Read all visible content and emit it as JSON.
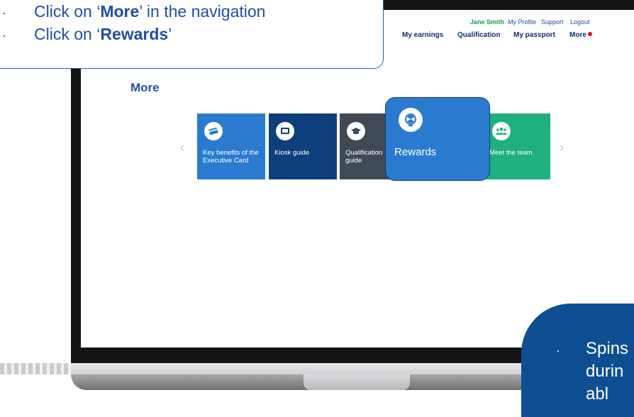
{
  "instructions": {
    "line1_prefix": "Click on ",
    "line1_bold": "More",
    "line1_suffix": " in the navigation",
    "line2_prefix": "Click on ",
    "line2_bold": "Rewards",
    "quote_open": "‘",
    "quote_close": "’",
    "bullet": "·"
  },
  "header": {
    "user_name": "Jane Smith",
    "links": [
      "My Profile",
      "Support",
      "Logout"
    ],
    "nav": [
      "My earnings",
      "Qualification",
      "My passport",
      "More"
    ],
    "notification_color": "#e0102a"
  },
  "page": {
    "title": "More"
  },
  "tiles": [
    {
      "label": "Key benefits of the Executive Card",
      "icon": "card-icon",
      "color": "#2a7bd0"
    },
    {
      "label": "Kiosk guide",
      "icon": "monitor-icon",
      "color": "#0d3f7c"
    },
    {
      "label": "Qualification guide",
      "icon": "graduation-cap-icon",
      "color": "#3f4a55"
    },
    {
      "label": "Rewards",
      "icon": "spin-wheel-icon",
      "color": "#2a7bd0"
    },
    {
      "label": "Meet the team",
      "icon": "team-icon",
      "color": "#1eb07e"
    }
  ],
  "carousel": {
    "prev": "‹",
    "next": "›"
  },
  "side_note": {
    "bullet": "·",
    "line1": "Spins",
    "line2": "durin",
    "line3": "abl"
  },
  "colors": {
    "brand_blue": "#1f4ea8",
    "dark_blue": "#0d4f92",
    "green": "#1eb07e"
  }
}
